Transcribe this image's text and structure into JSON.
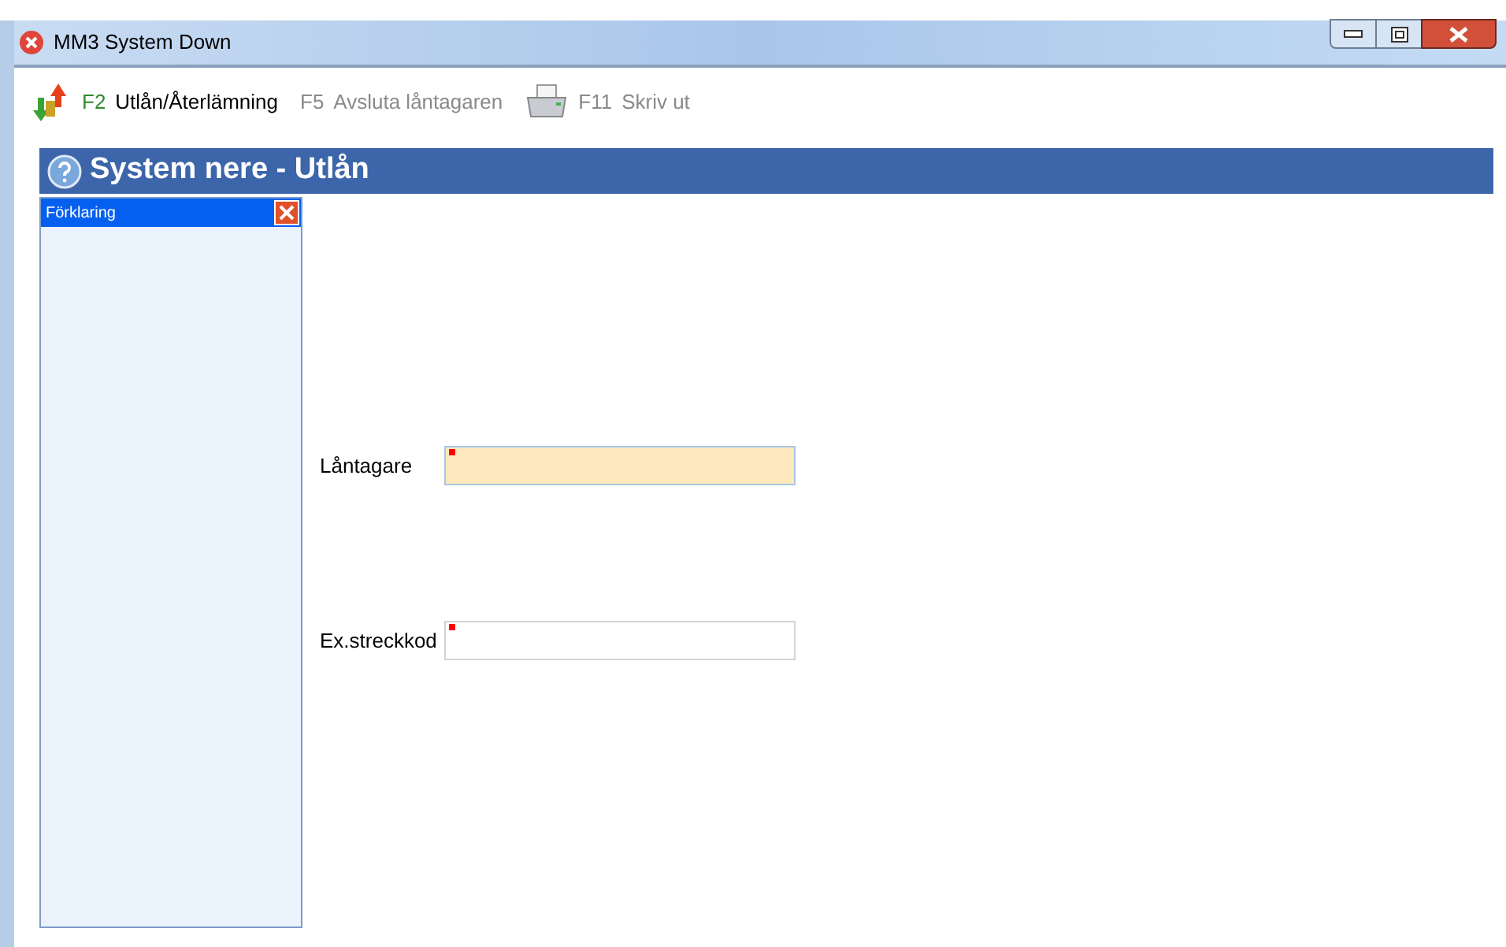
{
  "window": {
    "title": "MM3 System Down"
  },
  "toolbar": [
    {
      "kind": "arrows",
      "key": "F2",
      "label": "Utlån/Återlämning",
      "disabled": false
    },
    {
      "kind": "plain",
      "key": "F5",
      "label": "Avsluta låntagaren",
      "disabled": true
    },
    {
      "kind": "printer",
      "key": "F11",
      "label": "Skriv ut",
      "disabled": true
    }
  ],
  "header": {
    "title": "System nere - Utlån"
  },
  "sidebar": {
    "title": "Förklaring"
  },
  "form": [
    {
      "label": "Låntagare",
      "focused": true,
      "required": true
    },
    {
      "label": "Ex.streckkod",
      "focused": false,
      "required": true
    }
  ]
}
